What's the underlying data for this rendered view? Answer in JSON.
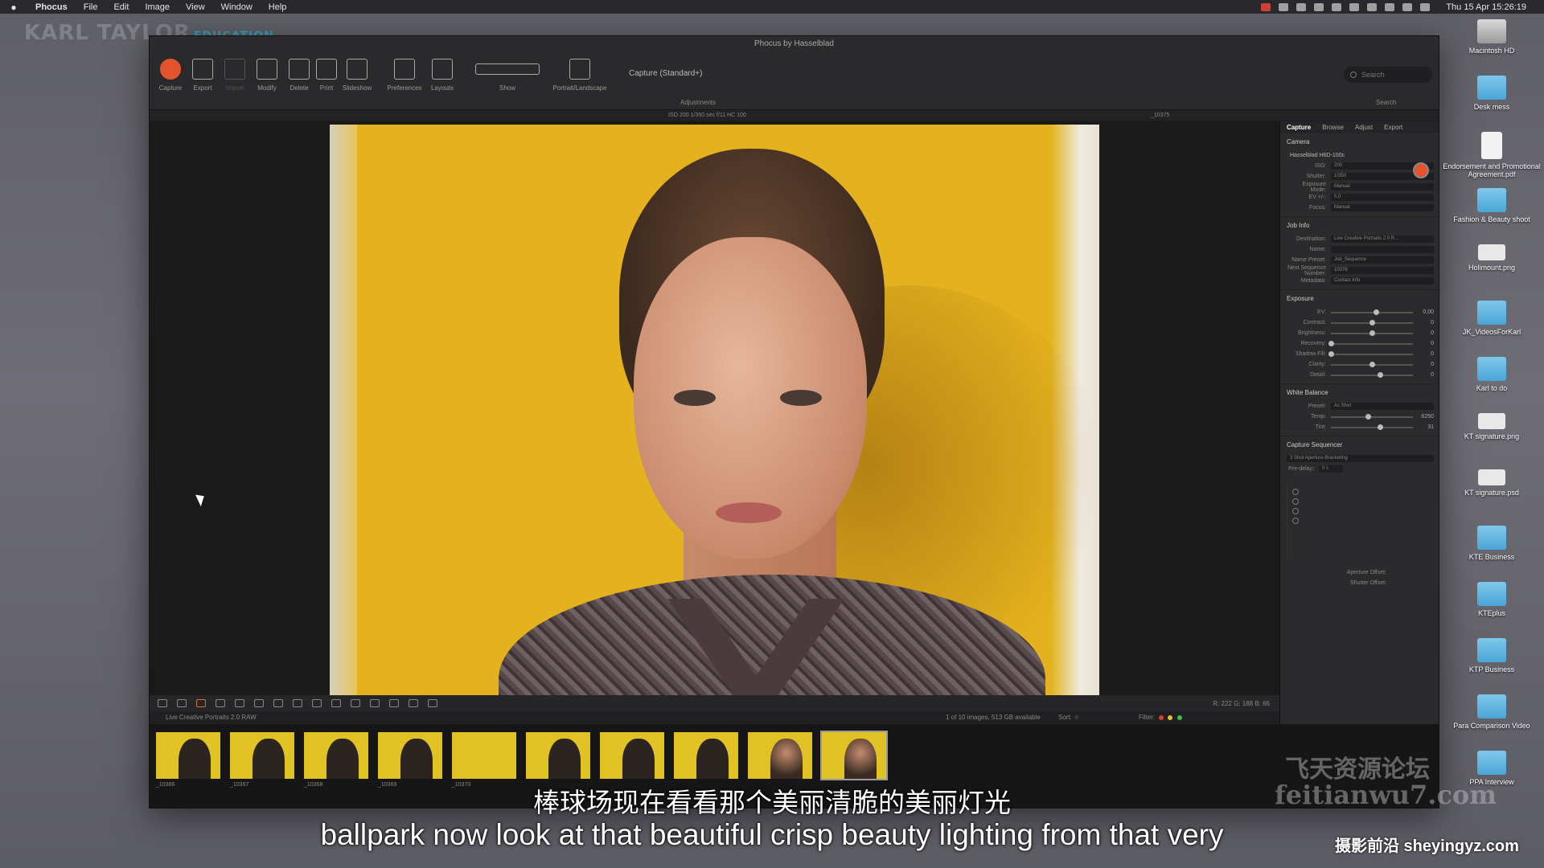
{
  "menubar": {
    "apple": "",
    "items": [
      "Phocus",
      "File",
      "Edit",
      "Image",
      "View",
      "Window",
      "Help"
    ],
    "clock": "Thu 15 Apr 15:26:19"
  },
  "brand": {
    "name": "KARL TAYLOR",
    "edu": "EDUCATION"
  },
  "window": {
    "title": "Phocus by Hasselblad",
    "toolbar": {
      "buttons": [
        "Capture",
        "Export",
        "Import",
        "Modify",
        "Delete",
        "Print",
        "Slideshow",
        "Preferences",
        "Layouts",
        "Show",
        "Portrait/Landscape"
      ],
      "capture_setting": "Capture (Standard+)",
      "adjustments_label": "Adjustments",
      "search_placeholder": "Search",
      "search_label": "Search"
    },
    "infobar": {
      "exif": "ISO 200  1/350 sec  f/11  HC 100",
      "filename": "_10375"
    },
    "viewer_readout": "R: 222  G: 188  B: 66",
    "status": {
      "folder": "Live Creative Portraits 2.0 RAW",
      "count": "1 of 10 images, 513 GB available",
      "sort_label": "Sort:",
      "filter_label": "Filter:"
    },
    "filmstrip": [
      {
        "label": "_10366",
        "kind": "dark"
      },
      {
        "label": "_10367",
        "kind": "dark"
      },
      {
        "label": "_10368",
        "kind": "dark"
      },
      {
        "label": "_10369",
        "kind": "dark"
      },
      {
        "label": "_10370",
        "kind": "plain"
      },
      {
        "label": "",
        "kind": "dark"
      },
      {
        "label": "",
        "kind": "dark"
      },
      {
        "label": "",
        "kind": "dark"
      },
      {
        "label": "",
        "kind": "lit"
      },
      {
        "label": "",
        "kind": "lit"
      }
    ]
  },
  "panel": {
    "tabs": [
      "Capture",
      "Browse",
      "Adjust",
      "Export"
    ],
    "camera": {
      "title": "Camera",
      "model": "Hasselblad H6D-100c",
      "rows": [
        {
          "label": "ISO:",
          "value": "200"
        },
        {
          "label": "Shutter:",
          "value": "1/350"
        },
        {
          "label": "Exposure Mode:",
          "value": "Manual"
        },
        {
          "label": "EV +/-:",
          "value": "0,0"
        },
        {
          "label": "Focus:",
          "value": "Manual"
        }
      ]
    },
    "jobinfo": {
      "title": "Job Info",
      "rows": [
        {
          "label": "Destination:",
          "value": "Live Creative Portraits 2.0 R..."
        },
        {
          "label": "Name:",
          "value": ""
        },
        {
          "label": "Name Preset:",
          "value": "Job_Sequence"
        },
        {
          "label": "Next Sequence Number:",
          "value": "10376"
        },
        {
          "label": "Metadata:",
          "value": "Contact Info"
        }
      ]
    },
    "exposure": {
      "title": "Exposure",
      "rows": [
        {
          "label": "EV:",
          "value": "0,00",
          "level": 0.55
        },
        {
          "label": "Contrast:",
          "value": "0",
          "level": 0.5
        },
        {
          "label": "Brightness:",
          "value": "0",
          "level": 0.5
        },
        {
          "label": "Recovery:",
          "value": "0",
          "level": 0.0
        },
        {
          "label": "Shadow Fill:",
          "value": "0",
          "level": 0.0
        },
        {
          "label": "Clarity:",
          "value": "0",
          "level": 0.5
        },
        {
          "label": "Detail:",
          "value": "0",
          "level": 0.6
        }
      ]
    },
    "whitebalance": {
      "title": "White Balance",
      "preset_label": "Preset:",
      "preset": "As Shot",
      "rows": [
        {
          "label": "Temp:",
          "value": "6250",
          "level": 0.45
        },
        {
          "label": "Tint:",
          "value": "31",
          "level": 0.6
        }
      ]
    },
    "sequencer": {
      "title": "Capture Sequencer",
      "mode": "3 Shot Aperture Bracketing",
      "predelay_label": "Pre-delay:",
      "predelay": "0 s",
      "aperture_offset": "Aperture Offset:",
      "shutter_offset": "Shutter Offset:"
    }
  },
  "desktop": [
    {
      "label": "Macintosh HD",
      "kind": "disk"
    },
    {
      "label": "Desk mess",
      "kind": "folder"
    },
    {
      "label": "Endorsement and Promotional Agreement.pdf",
      "kind": "file"
    },
    {
      "label": "Fashion & Beauty shoot",
      "kind": "folder"
    },
    {
      "label": "Holimount.png",
      "kind": "img"
    },
    {
      "label": "JK_VideosForKarl",
      "kind": "folder"
    },
    {
      "label": "Karl to do",
      "kind": "folder"
    },
    {
      "label": "KT signature.png",
      "kind": "img"
    },
    {
      "label": "KT signature.psd",
      "kind": "img"
    },
    {
      "label": "KTE Business",
      "kind": "folder"
    },
    {
      "label": "KTEplus",
      "kind": "folder"
    },
    {
      "label": "KTP Business",
      "kind": "folder"
    },
    {
      "label": "Para Comparison Video",
      "kind": "folder"
    },
    {
      "label": "PPA Interview",
      "kind": "folder"
    }
  ],
  "subtitles": {
    "cn": "棒球场现在看看那个美丽清脆的美丽灯光",
    "en": "ballpark now look at that beautiful crisp beauty lighting from that very"
  },
  "watermarks": {
    "cn": "飞天资源论坛",
    "url": "feitianwu7.com",
    "site": "摄影前沿 sheyingyz.com"
  }
}
